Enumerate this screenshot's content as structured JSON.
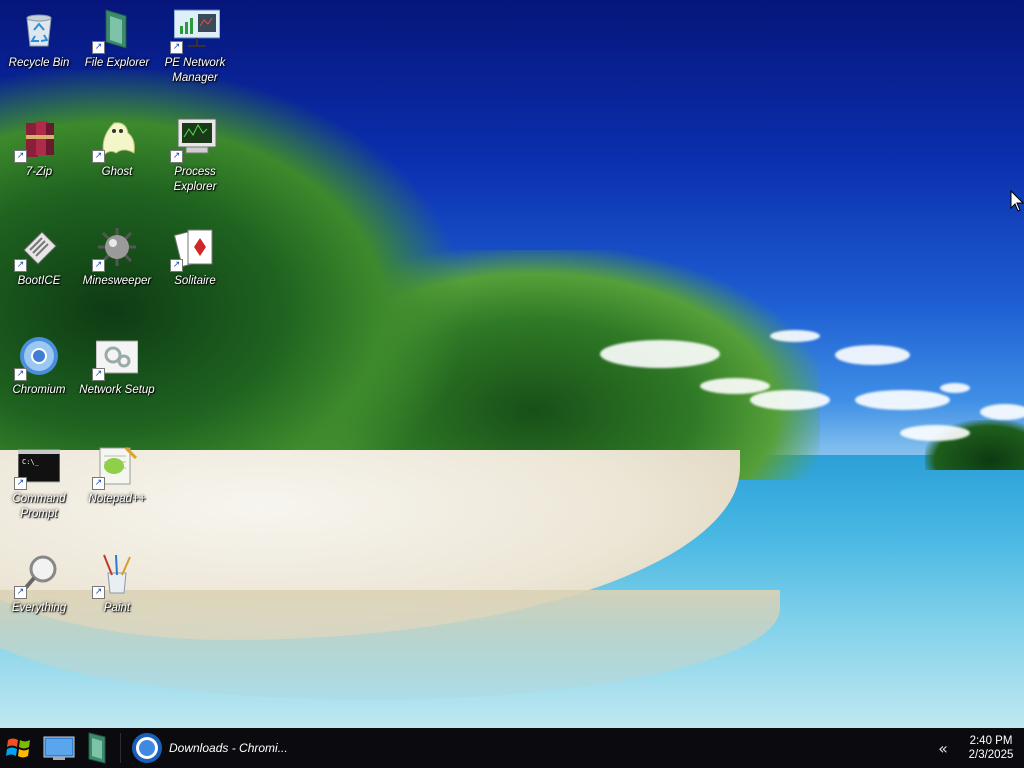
{
  "desktop": {
    "icons": [
      {
        "label": "Recycle Bin",
        "icon": "recycle-bin-icon",
        "shortcut": false
      },
      {
        "label": "File Explorer",
        "icon": "file-explorer-icon",
        "shortcut": true
      },
      {
        "label": "PE Network Manager",
        "icon": "network-manager-icon",
        "shortcut": true
      },
      {
        "label": "7-Zip",
        "icon": "7zip-icon",
        "shortcut": true
      },
      {
        "label": "Ghost",
        "icon": "ghost-icon",
        "shortcut": true
      },
      {
        "label": "Process Explorer",
        "icon": "process-explorer-icon",
        "shortcut": true
      },
      {
        "label": "BootICE",
        "icon": "bootice-icon",
        "shortcut": true
      },
      {
        "label": "Minesweeper",
        "icon": "minesweeper-icon",
        "shortcut": true
      },
      {
        "label": "Solitaire",
        "icon": "solitaire-icon",
        "shortcut": true
      },
      {
        "label": "Chromium",
        "icon": "chromium-icon",
        "shortcut": true
      },
      {
        "label": "Network Setup",
        "icon": "network-setup-icon",
        "shortcut": true
      },
      {
        "label": "Command Prompt",
        "icon": "command-prompt-icon",
        "shortcut": true
      },
      {
        "label": "Notepad++",
        "icon": "notepadpp-icon",
        "shortcut": true
      },
      {
        "label": "Everything",
        "icon": "everything-icon",
        "shortcut": true
      },
      {
        "label": "Paint",
        "icon": "paint-icon",
        "shortcut": true
      }
    ]
  },
  "taskbar": {
    "start_icon": "windows-start-icon",
    "pinned": [
      {
        "icon": "desktop-monitor-icon"
      },
      {
        "icon": "file-explorer-icon"
      }
    ],
    "tasks": [
      {
        "label": "Downloads - Chromi...",
        "icon": "chromium-icon"
      }
    ],
    "tray": {
      "chevron": "«",
      "time": "2:40 PM",
      "date": "2/3/2025"
    }
  },
  "colors": {
    "taskbar_bg": "#0b0b0f",
    "sky_top": "#06157a",
    "sea": "#49b8e3"
  }
}
